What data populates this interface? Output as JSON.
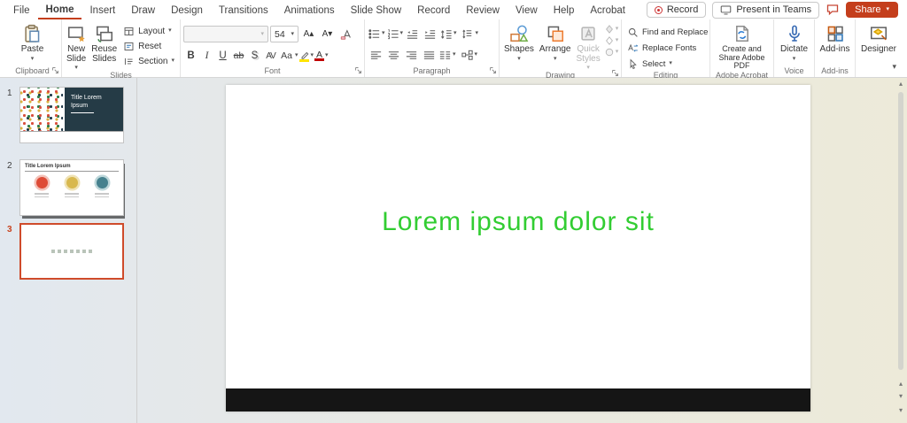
{
  "menu": {
    "items": [
      "File",
      "Home",
      "Insert",
      "Draw",
      "Design",
      "Transitions",
      "Animations",
      "Slide Show",
      "Record",
      "Review",
      "View",
      "Help",
      "Acrobat"
    ],
    "active_item": "Home"
  },
  "titlebar": {
    "record": "Record",
    "present_in_teams": "Present in Teams",
    "share": "Share"
  },
  "icons": {
    "dropdown": "▾",
    "scroll_up": "▴",
    "scroll_down": "▾",
    "collapse_ribbon": "▾",
    "increase_font": "A▴",
    "decrease_font": "A▾"
  },
  "ribbon": {
    "clipboard": {
      "group_label": "Clipboard",
      "paste": "Paste"
    },
    "slides": {
      "group_label": "Slides",
      "new_slide": "New Slide",
      "reuse_slides": "Reuse Slides",
      "layout": "Layout",
      "reset": "Reset",
      "section": "Section"
    },
    "font": {
      "group_label": "Font",
      "font_name_value": "",
      "font_size_value": "54",
      "bold": "B",
      "italic": "I",
      "underline": "U",
      "strikethrough": "ab",
      "shadow": "S",
      "char_spacing": "AV",
      "change_case": "Aa",
      "font_color": "A",
      "highlight": "A"
    },
    "paragraph": {
      "group_label": "Paragraph"
    },
    "drawing": {
      "group_label": "Drawing",
      "shapes": "Shapes",
      "arrange": "Arrange",
      "quick_styles": "Quick Styles"
    },
    "editing": {
      "group_label": "Editing",
      "find": "Find and Replace",
      "replace_fonts": "Replace Fonts",
      "select": "Select"
    },
    "acrobat": {
      "group_label": "Adobe Acrobat",
      "create_pdf": "Create and Share Adobe PDF"
    },
    "voice": {
      "group_label": "Voice",
      "dictate": "Dictate"
    },
    "addins": {
      "group_label": "Add-ins",
      "button": "Add-ins"
    },
    "designer": {
      "button": "Designer"
    }
  },
  "slide_panel": {
    "slides": [
      {
        "number": "1",
        "title": "Title Lorem Ipsum"
      },
      {
        "number": "2",
        "title": "Title Lorem Ipsum"
      },
      {
        "number": "3",
        "title": ""
      }
    ]
  },
  "canvas": {
    "slide_text": "Lorem ipsum dolor sit",
    "slide_text_color": "#32CD32",
    "footer_bar_color": "#151515",
    "accent_color": "#C43E1C"
  }
}
